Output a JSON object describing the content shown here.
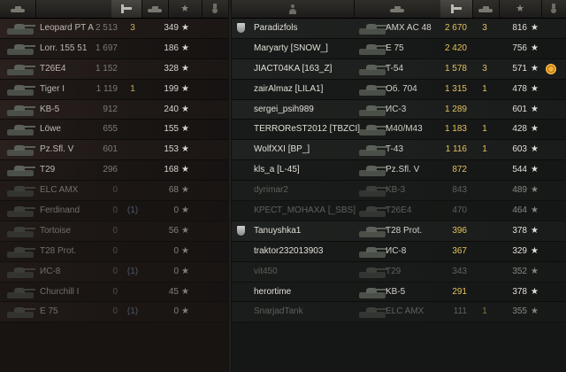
{
  "left_team": {
    "rows": [
      {
        "vehicle": "Leopard PT A",
        "damage": "2 513",
        "kills": "3",
        "xp": "349",
        "dead": false
      },
      {
        "vehicle": "Lorr. 155 51",
        "damage": "1 697",
        "kills": "",
        "xp": "186",
        "dead": false
      },
      {
        "vehicle": "T26E4",
        "damage": "1 152",
        "kills": "",
        "xp": "328",
        "dead": false
      },
      {
        "vehicle": "Tiger I",
        "damage": "1 119",
        "kills": "1",
        "xp": "199",
        "dead": false
      },
      {
        "vehicle": "KB-5",
        "damage": "912",
        "kills": "",
        "xp": "240",
        "dead": false
      },
      {
        "vehicle": "Löwe",
        "damage": "655",
        "kills": "",
        "xp": "155",
        "dead": false
      },
      {
        "vehicle": "Pz.Sfl. V",
        "damage": "601",
        "kills": "",
        "xp": "153",
        "dead": false
      },
      {
        "vehicle": "T29",
        "damage": "296",
        "kills": "",
        "xp": "168",
        "dead": false
      },
      {
        "vehicle": "ELC AMX",
        "damage": "0",
        "kills": "",
        "xp": "68",
        "dead": true
      },
      {
        "vehicle": "Ferdinand",
        "damage": "0",
        "kills": "(1)",
        "xp": "0",
        "dead": true
      },
      {
        "vehicle": "Tortoise",
        "damage": "0",
        "kills": "",
        "xp": "56",
        "dead": true
      },
      {
        "vehicle": "T28 Prot.",
        "damage": "0",
        "kills": "",
        "xp": "0",
        "dead": true
      },
      {
        "vehicle": "ИС-8",
        "damage": "0",
        "kills": "(1)",
        "xp": "0",
        "dead": true
      },
      {
        "vehicle": "Churchill I",
        "damage": "0",
        "kills": "",
        "xp": "45",
        "dead": true
      },
      {
        "vehicle": "E 75",
        "damage": "0",
        "kills": "(1)",
        "xp": "0",
        "dead": true
      }
    ]
  },
  "right_team": {
    "rows": [
      {
        "badge": "shield",
        "player": "Paradizfols",
        "vehicle": "AMX AC 48",
        "damage": "2 670",
        "kills": "3",
        "xp": "816",
        "medal": "",
        "dead": false
      },
      {
        "badge": "",
        "player": "Maryarty [SNOW_]",
        "vehicle": "E 75",
        "damage": "2 420",
        "kills": "",
        "xp": "756",
        "medal": "",
        "dead": false
      },
      {
        "badge": "",
        "player": "JIACT04KA [163_Z]",
        "vehicle": "T-54",
        "damage": "1 578",
        "kills": "3",
        "xp": "571",
        "medal": "gear",
        "dead": false
      },
      {
        "badge": "",
        "player": "zairAlmaz [LILA1]",
        "vehicle": "Об. 704",
        "damage": "1 315",
        "kills": "1",
        "xp": "478",
        "medal": "",
        "dead": false
      },
      {
        "badge": "",
        "player": "sergei_psih989",
        "vehicle": "ИС-3",
        "damage": "1 289",
        "kills": "",
        "xp": "601",
        "medal": "",
        "dead": false
      },
      {
        "badge": "",
        "player": "TERRORеST2012 [TBZCI]",
        "vehicle": "M40/M43",
        "damage": "1 183",
        "kills": "1",
        "xp": "428",
        "medal": "",
        "dead": false
      },
      {
        "badge": "",
        "player": "WolfXXI [BP_]",
        "vehicle": "T-43",
        "damage": "1 116",
        "kills": "1",
        "xp": "603",
        "medal": "",
        "dead": false
      },
      {
        "badge": "",
        "player": "kls_a [L-45]",
        "vehicle": "Pz.Sfl. V",
        "damage": "872",
        "kills": "",
        "xp": "544",
        "medal": "",
        "dead": false
      },
      {
        "badge": "",
        "player": "dyrimar2",
        "vehicle": "KB-3",
        "damage": "843",
        "kills": "",
        "xp": "489",
        "medal": "",
        "dead": true
      },
      {
        "badge": "",
        "player": "КРЕСТ_МОНАХА [_SBS]",
        "vehicle": "T26E4",
        "damage": "470",
        "kills": "",
        "xp": "464",
        "medal": "",
        "dead": true
      },
      {
        "badge": "shield",
        "player": "Tanuyshka1",
        "vehicle": "T28 Prot.",
        "damage": "396",
        "kills": "",
        "xp": "378",
        "medal": "",
        "dead": false
      },
      {
        "badge": "",
        "player": "traktor232013903",
        "vehicle": "ИС-8",
        "damage": "367",
        "kills": "",
        "xp": "329",
        "medal": "",
        "dead": false
      },
      {
        "badge": "",
        "player": "vit450",
        "vehicle": "T29",
        "damage": "343",
        "kills": "",
        "xp": "352",
        "medal": "",
        "dead": true
      },
      {
        "badge": "",
        "player": "herortime",
        "vehicle": "KB-5",
        "damage": "291",
        "kills": "",
        "xp": "378",
        "medal": "",
        "dead": false
      },
      {
        "badge": "",
        "player": "SnarjadTank",
        "vehicle": "ELC AMX",
        "damage": "111",
        "kills": "1",
        "xp": "355",
        "medal": "",
        "dead": true
      }
    ]
  },
  "star_glyph": "★"
}
